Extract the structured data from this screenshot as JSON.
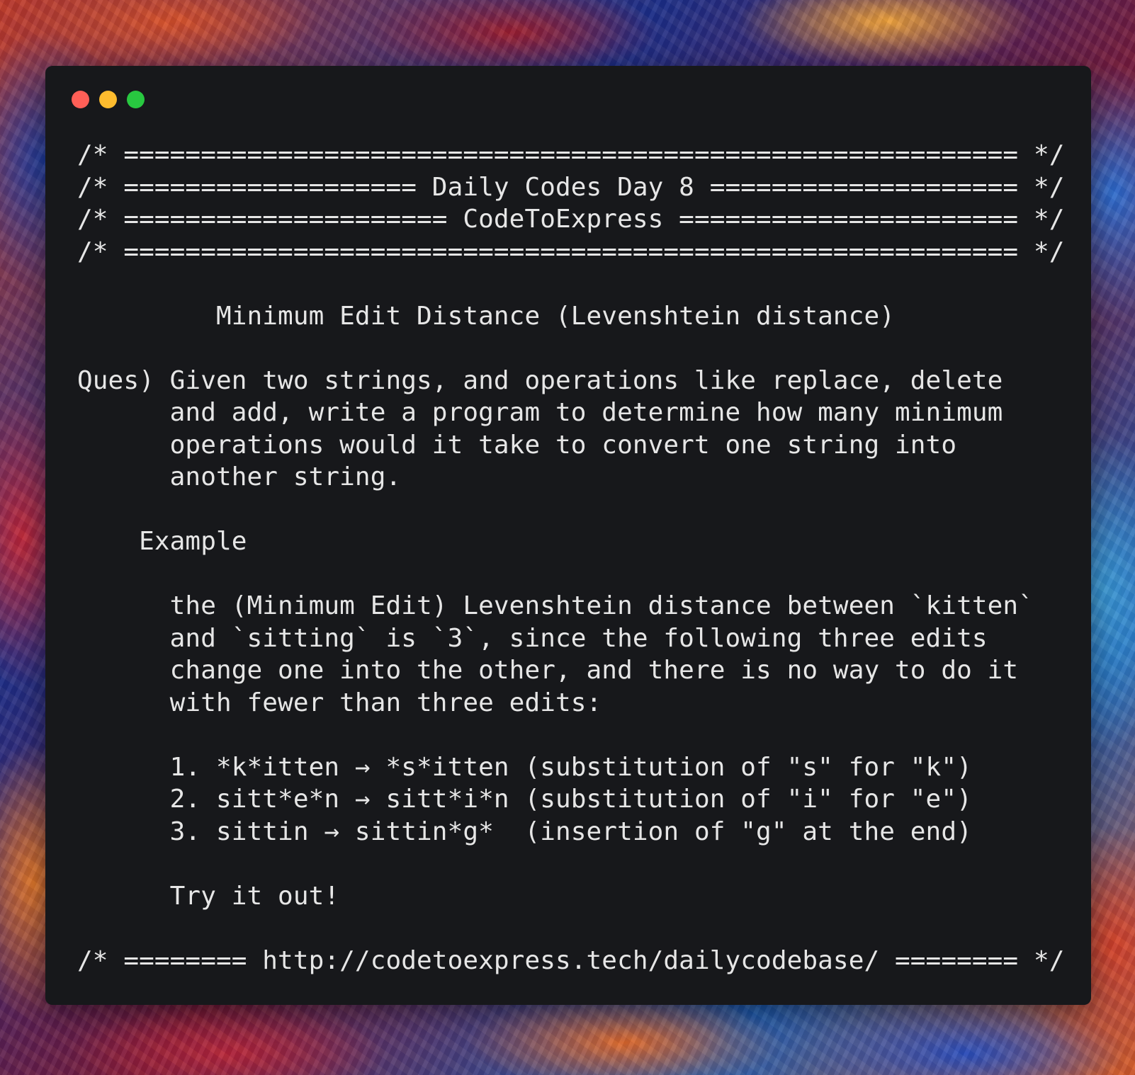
{
  "window": {
    "controls": [
      {
        "name": "close",
        "color": "#ff5f57"
      },
      {
        "name": "minimize",
        "color": "#febc2e"
      },
      {
        "name": "zoom",
        "color": "#28c840"
      }
    ]
  },
  "code": {
    "header": [
      "/* ========================================================== */",
      "/* =================== Daily Codes Day 8 ==================== */",
      "/* ===================== CodeToExpress ====================== */",
      "/* ========================================================== */"
    ],
    "title": "         Minimum Edit Distance (Levenshtein distance)",
    "question": [
      "Ques) Given two strings, and operations like replace, delete",
      "      and add, write a program to determine how many minimum",
      "      operations would it take to convert one string into",
      "      another string."
    ],
    "example_heading": "    Example",
    "example_text": [
      "      the (Minimum Edit) Levenshtein distance between `kitten`",
      "      and `sitting` is `3`, since the following three edits",
      "      change one into the other, and there is no way to do it",
      "      with fewer than three edits:"
    ],
    "steps": [
      "      1. *k*itten → *s*itten (substitution of \"s\" for \"k\")",
      "      2. sitt*e*n → sitt*i*n (substitution of \"i\" for \"e\")",
      "      3. sittin → sittin*g*  (insertion of \"g\" at the end)"
    ],
    "closing": "      Try it out!",
    "footer": "/* ======== http://codetoexpress.tech/dailycodebase/ ======== */"
  }
}
